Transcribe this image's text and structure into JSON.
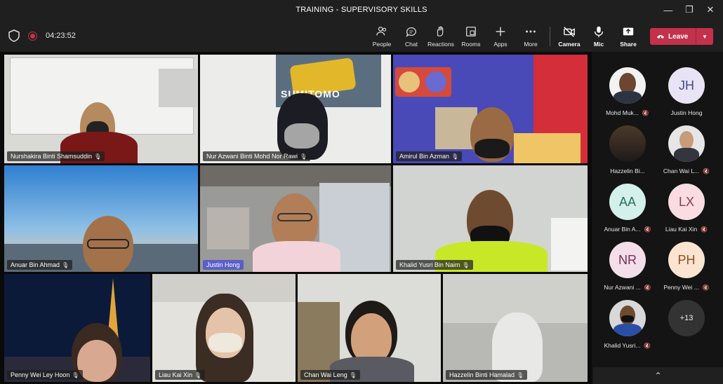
{
  "window": {
    "title": "TRAINING - SUPERVISORY SKILLS"
  },
  "toolbar": {
    "timer": "04:23:52",
    "buttons": [
      {
        "label": "People",
        "icon": "people-icon"
      },
      {
        "label": "Chat",
        "icon": "chat-icon"
      },
      {
        "label": "Reactions",
        "icon": "reactions-icon"
      },
      {
        "label": "Rooms",
        "icon": "rooms-icon"
      },
      {
        "label": "Apps",
        "icon": "plus-icon"
      },
      {
        "label": "More",
        "icon": "more-icon"
      },
      {
        "label": "Camera",
        "icon": "camera-off-icon"
      },
      {
        "label": "Mic",
        "icon": "mic-icon"
      },
      {
        "label": "Share",
        "icon": "share-icon"
      }
    ],
    "leave_label": "Leave"
  },
  "video_tiles": [
    {
      "name": "Nurshakira Binti Shamsuddin"
    },
    {
      "name": "Nur Azwani Binti Mohd Nor Rawi"
    },
    {
      "name": "Amirul Bin Azman"
    },
    {
      "name": "Anuar Bin Ahmad"
    },
    {
      "name": "Justin Hong"
    },
    {
      "name": "Khalid Yusri Bin Naim"
    },
    {
      "name": "Penny Wei Ley Hoon"
    },
    {
      "name": "Liau Kai Xin"
    },
    {
      "name": "Chan Wai Leng"
    },
    {
      "name": "Hazzelin Binti Hamalad"
    }
  ],
  "poster_text": "SUMITOMO",
  "roster": [
    {
      "name": "Mohd Muk...",
      "initials": ""
    },
    {
      "name": "Justin Hong",
      "initials": "JH"
    },
    {
      "name": "Hazzelin Bi...",
      "initials": ""
    },
    {
      "name": "Chan Wai L...",
      "initials": ""
    },
    {
      "name": "Anuar Bin A...",
      "initials": "AA"
    },
    {
      "name": "Liau Kai Xin",
      "initials": "LX"
    },
    {
      "name": "Nur Azwani ...",
      "initials": "NR"
    },
    {
      "name": "Penny Wei ...",
      "initials": "PH"
    },
    {
      "name": "Khalid Yusri...",
      "initials": ""
    }
  ],
  "overflow_count": "+13",
  "colors": {
    "leave": "#c4314b",
    "active_speaker": "#5b5fc7"
  }
}
